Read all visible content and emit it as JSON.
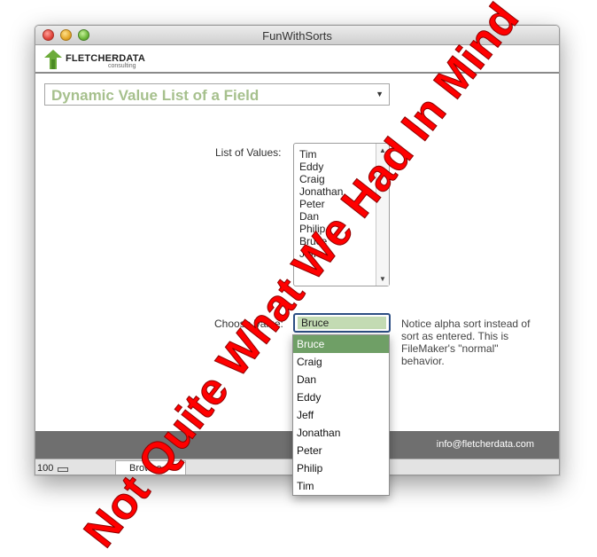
{
  "window": {
    "title": "FunWithSorts"
  },
  "header": {
    "logo_name": "FLETCHERDATA",
    "logo_sub": "consulting"
  },
  "layout_select": {
    "label": "Dynamic Value List of a Field"
  },
  "list_label": "List of Values:",
  "list_values": [
    "Tim",
    "Eddy",
    "Craig",
    "Jonathan",
    "Peter",
    "Dan",
    "Philip",
    "Bruce",
    "Jeff"
  ],
  "choose_label": "Choose Value:",
  "choose_value": "Bruce",
  "note": "Notice alpha sort instead of sort as entered. This is FileMaker's \"normal\" behavior.",
  "dropdown_options": [
    "Bruce",
    "Craig",
    "Dan",
    "Eddy",
    "Jeff",
    "Jonathan",
    "Peter",
    "Philip",
    "Tim"
  ],
  "footer": {
    "email": "info@fletcherdata.com"
  },
  "statusbar": {
    "zoom": "100",
    "mode": "Browse"
  },
  "overlay_text": "Not Quite What We Had In Mind",
  "colors": {
    "selected": "#6f9f66",
    "field_highlight": "#c3dbb3",
    "overlay": "#ff0000",
    "layout_title": "#a6c08d",
    "footer": "#6f6f6f"
  }
}
